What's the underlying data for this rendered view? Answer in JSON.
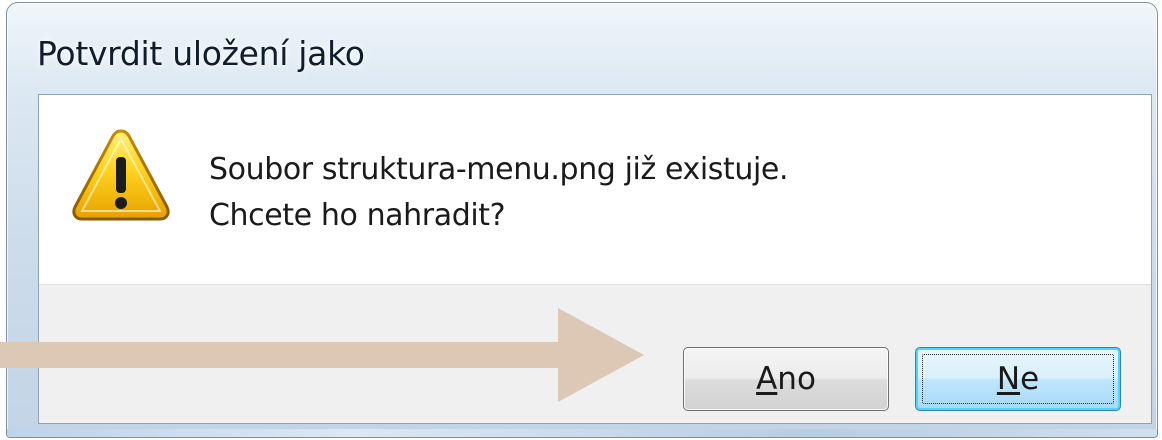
{
  "dialog": {
    "title": "Potvrdit uložení jako",
    "message_line1": "Soubor struktura-menu.png již existuje.",
    "message_line2": "Chcete ho nahradit?",
    "icon": "warning-icon"
  },
  "buttons": {
    "yes": {
      "mnemonic": "A",
      "rest": "no"
    },
    "no": {
      "mnemonic": "N",
      "rest": "e"
    }
  },
  "colors": {
    "arrow": "#dcc8b4",
    "warning_yellow": "#f5c800",
    "focus_button": "#bee6fd"
  }
}
